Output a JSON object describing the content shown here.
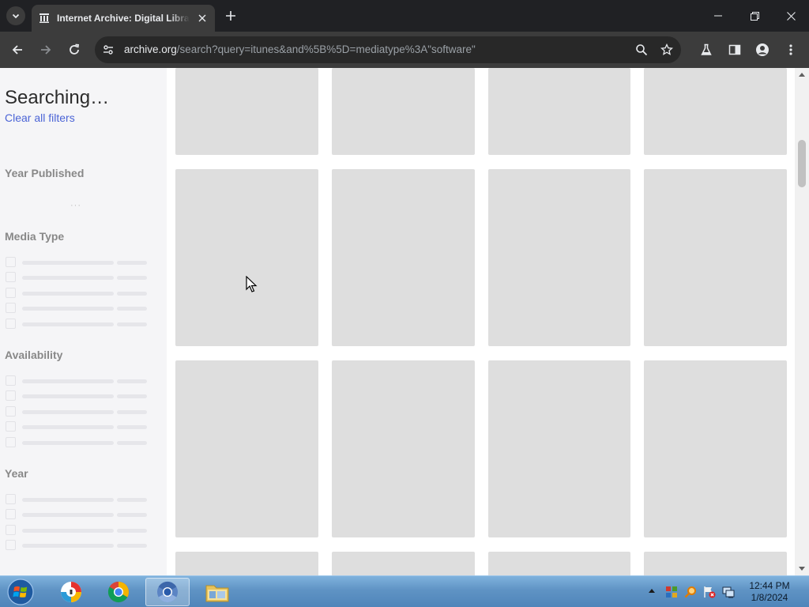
{
  "browser": {
    "tab_title": "Internet Archive: Digital Library of Free & Borrowable Books, Movies, Music & Wayback Machine",
    "url_host": "archive.org",
    "url_path": "/search?query=itunes&and%5B%5D=mediatype%3A\"software\""
  },
  "sidebar": {
    "results_title": "Searching…",
    "clear_filters": "Clear all filters",
    "year_published_heading": "Year Published",
    "year_published_placeholder": "···",
    "media_type_heading": "Media Type",
    "availability_heading": "Availability",
    "year_heading": "Year"
  },
  "taskbar": {
    "time": "12:44 PM",
    "date": "1/8/2024"
  },
  "colors": {
    "link": "#4b64d6",
    "tile_placeholder": "#dedede",
    "sidebar_bg": "#f5f5f7",
    "chrome_dark": "#202124"
  },
  "icons": {
    "tab_favicon": "archive-building-icon",
    "tab_search": "chevron-down-icon",
    "omnibox_info": "site-info-icon",
    "omnibox_search": "search-icon",
    "omnibox_bookmark": "star-icon",
    "labs": "flask-icon",
    "side_panel": "side-panel-icon",
    "profile": "profile-icon",
    "menu": "more-vert-icon"
  }
}
